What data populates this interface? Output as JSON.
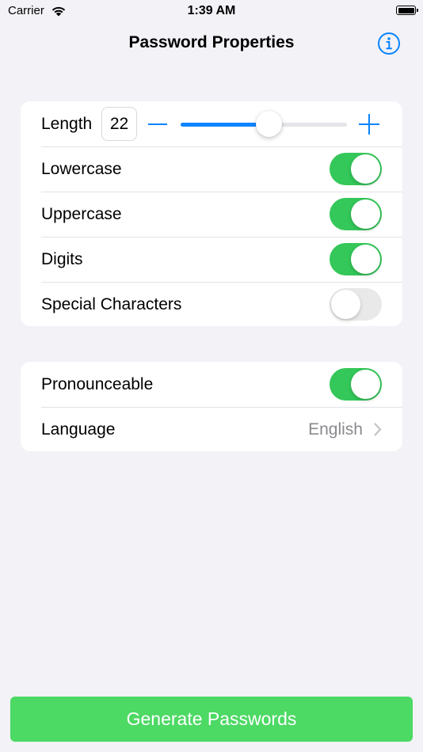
{
  "status_bar": {
    "carrier": "Carrier",
    "time": "1:39 AM",
    "icons": [
      "wifi-icon",
      "battery-icon"
    ]
  },
  "nav": {
    "title": "Password Properties",
    "info_icon": "info-circle-icon"
  },
  "colors": {
    "background": "#f2f2f7",
    "accent": "#0a84ff",
    "switch_on": "#34c759",
    "switch_off": "#e9e9ea",
    "button": "#4cd964",
    "secondary_text": "#8a8a8e"
  },
  "length": {
    "label": "Length",
    "value": "22",
    "slider_fraction": 0.53,
    "decrement_icon": "minus-icon",
    "increment_icon": "plus-icon"
  },
  "options": [
    {
      "label": "Lowercase",
      "on": true
    },
    {
      "label": "Uppercase",
      "on": true
    },
    {
      "label": "Digits",
      "on": true
    },
    {
      "label": "Special Characters",
      "on": false
    }
  ],
  "pronounceable": {
    "label": "Pronounceable",
    "on": true
  },
  "language": {
    "label": "Language",
    "value": "English",
    "icon": "chevron-right-icon"
  },
  "generate_button": {
    "label": "Generate Passwords"
  }
}
